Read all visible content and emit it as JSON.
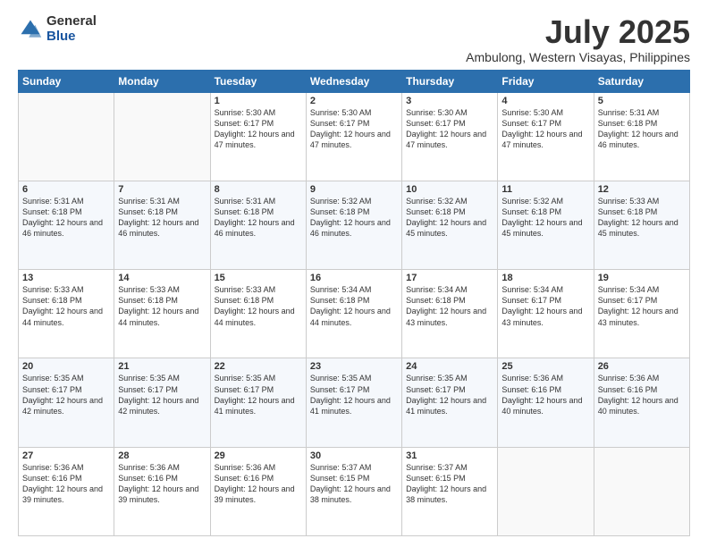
{
  "logo": {
    "general": "General",
    "blue": "Blue"
  },
  "title": "July 2025",
  "subtitle": "Ambulong, Western Visayas, Philippines",
  "days_of_week": [
    "Sunday",
    "Monday",
    "Tuesday",
    "Wednesday",
    "Thursday",
    "Friday",
    "Saturday"
  ],
  "weeks": [
    [
      {
        "day": "",
        "sunrise": "",
        "sunset": "",
        "daylight": ""
      },
      {
        "day": "",
        "sunrise": "",
        "sunset": "",
        "daylight": ""
      },
      {
        "day": "1",
        "sunrise": "Sunrise: 5:30 AM",
        "sunset": "Sunset: 6:17 PM",
        "daylight": "Daylight: 12 hours and 47 minutes."
      },
      {
        "day": "2",
        "sunrise": "Sunrise: 5:30 AM",
        "sunset": "Sunset: 6:17 PM",
        "daylight": "Daylight: 12 hours and 47 minutes."
      },
      {
        "day": "3",
        "sunrise": "Sunrise: 5:30 AM",
        "sunset": "Sunset: 6:17 PM",
        "daylight": "Daylight: 12 hours and 47 minutes."
      },
      {
        "day": "4",
        "sunrise": "Sunrise: 5:30 AM",
        "sunset": "Sunset: 6:17 PM",
        "daylight": "Daylight: 12 hours and 47 minutes."
      },
      {
        "day": "5",
        "sunrise": "Sunrise: 5:31 AM",
        "sunset": "Sunset: 6:18 PM",
        "daylight": "Daylight: 12 hours and 46 minutes."
      }
    ],
    [
      {
        "day": "6",
        "sunrise": "Sunrise: 5:31 AM",
        "sunset": "Sunset: 6:18 PM",
        "daylight": "Daylight: 12 hours and 46 minutes."
      },
      {
        "day": "7",
        "sunrise": "Sunrise: 5:31 AM",
        "sunset": "Sunset: 6:18 PM",
        "daylight": "Daylight: 12 hours and 46 minutes."
      },
      {
        "day": "8",
        "sunrise": "Sunrise: 5:31 AM",
        "sunset": "Sunset: 6:18 PM",
        "daylight": "Daylight: 12 hours and 46 minutes."
      },
      {
        "day": "9",
        "sunrise": "Sunrise: 5:32 AM",
        "sunset": "Sunset: 6:18 PM",
        "daylight": "Daylight: 12 hours and 46 minutes."
      },
      {
        "day": "10",
        "sunrise": "Sunrise: 5:32 AM",
        "sunset": "Sunset: 6:18 PM",
        "daylight": "Daylight: 12 hours and 45 minutes."
      },
      {
        "day": "11",
        "sunrise": "Sunrise: 5:32 AM",
        "sunset": "Sunset: 6:18 PM",
        "daylight": "Daylight: 12 hours and 45 minutes."
      },
      {
        "day": "12",
        "sunrise": "Sunrise: 5:33 AM",
        "sunset": "Sunset: 6:18 PM",
        "daylight": "Daylight: 12 hours and 45 minutes."
      }
    ],
    [
      {
        "day": "13",
        "sunrise": "Sunrise: 5:33 AM",
        "sunset": "Sunset: 6:18 PM",
        "daylight": "Daylight: 12 hours and 44 minutes."
      },
      {
        "day": "14",
        "sunrise": "Sunrise: 5:33 AM",
        "sunset": "Sunset: 6:18 PM",
        "daylight": "Daylight: 12 hours and 44 minutes."
      },
      {
        "day": "15",
        "sunrise": "Sunrise: 5:33 AM",
        "sunset": "Sunset: 6:18 PM",
        "daylight": "Daylight: 12 hours and 44 minutes."
      },
      {
        "day": "16",
        "sunrise": "Sunrise: 5:34 AM",
        "sunset": "Sunset: 6:18 PM",
        "daylight": "Daylight: 12 hours and 44 minutes."
      },
      {
        "day": "17",
        "sunrise": "Sunrise: 5:34 AM",
        "sunset": "Sunset: 6:18 PM",
        "daylight": "Daylight: 12 hours and 43 minutes."
      },
      {
        "day": "18",
        "sunrise": "Sunrise: 5:34 AM",
        "sunset": "Sunset: 6:17 PM",
        "daylight": "Daylight: 12 hours and 43 minutes."
      },
      {
        "day": "19",
        "sunrise": "Sunrise: 5:34 AM",
        "sunset": "Sunset: 6:17 PM",
        "daylight": "Daylight: 12 hours and 43 minutes."
      }
    ],
    [
      {
        "day": "20",
        "sunrise": "Sunrise: 5:35 AM",
        "sunset": "Sunset: 6:17 PM",
        "daylight": "Daylight: 12 hours and 42 minutes."
      },
      {
        "day": "21",
        "sunrise": "Sunrise: 5:35 AM",
        "sunset": "Sunset: 6:17 PM",
        "daylight": "Daylight: 12 hours and 42 minutes."
      },
      {
        "day": "22",
        "sunrise": "Sunrise: 5:35 AM",
        "sunset": "Sunset: 6:17 PM",
        "daylight": "Daylight: 12 hours and 41 minutes."
      },
      {
        "day": "23",
        "sunrise": "Sunrise: 5:35 AM",
        "sunset": "Sunset: 6:17 PM",
        "daylight": "Daylight: 12 hours and 41 minutes."
      },
      {
        "day": "24",
        "sunrise": "Sunrise: 5:35 AM",
        "sunset": "Sunset: 6:17 PM",
        "daylight": "Daylight: 12 hours and 41 minutes."
      },
      {
        "day": "25",
        "sunrise": "Sunrise: 5:36 AM",
        "sunset": "Sunset: 6:16 PM",
        "daylight": "Daylight: 12 hours and 40 minutes."
      },
      {
        "day": "26",
        "sunrise": "Sunrise: 5:36 AM",
        "sunset": "Sunset: 6:16 PM",
        "daylight": "Daylight: 12 hours and 40 minutes."
      }
    ],
    [
      {
        "day": "27",
        "sunrise": "Sunrise: 5:36 AM",
        "sunset": "Sunset: 6:16 PM",
        "daylight": "Daylight: 12 hours and 39 minutes."
      },
      {
        "day": "28",
        "sunrise": "Sunrise: 5:36 AM",
        "sunset": "Sunset: 6:16 PM",
        "daylight": "Daylight: 12 hours and 39 minutes."
      },
      {
        "day": "29",
        "sunrise": "Sunrise: 5:36 AM",
        "sunset": "Sunset: 6:16 PM",
        "daylight": "Daylight: 12 hours and 39 minutes."
      },
      {
        "day": "30",
        "sunrise": "Sunrise: 5:37 AM",
        "sunset": "Sunset: 6:15 PM",
        "daylight": "Daylight: 12 hours and 38 minutes."
      },
      {
        "day": "31",
        "sunrise": "Sunrise: 5:37 AM",
        "sunset": "Sunset: 6:15 PM",
        "daylight": "Daylight: 12 hours and 38 minutes."
      },
      {
        "day": "",
        "sunrise": "",
        "sunset": "",
        "daylight": ""
      },
      {
        "day": "",
        "sunrise": "",
        "sunset": "",
        "daylight": ""
      }
    ]
  ]
}
